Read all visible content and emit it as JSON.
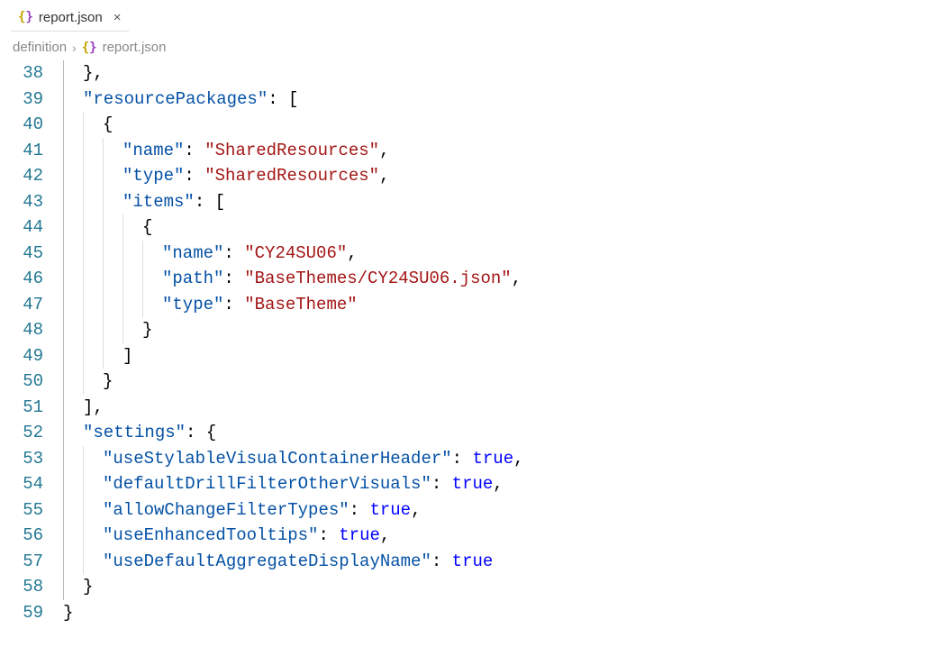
{
  "tab": {
    "filename": "report.json",
    "close": "×"
  },
  "breadcrumb": {
    "folder": "definition",
    "file": "report.json"
  },
  "lineStart": 38,
  "lines": [
    {
      "indent": 1,
      "tokens": [
        [
          "brace",
          "}"
        ],
        [
          "comma",
          ","
        ]
      ]
    },
    {
      "indent": 1,
      "tokens": [
        [
          "key",
          "\"resourcePackages\""
        ],
        [
          "colon",
          ":"
        ],
        [
          "sp",
          " "
        ],
        [
          "bracket",
          "["
        ]
      ]
    },
    {
      "indent": 2,
      "tokens": [
        [
          "brace",
          "{"
        ]
      ]
    },
    {
      "indent": 3,
      "tokens": [
        [
          "key",
          "\"name\""
        ],
        [
          "colon",
          ":"
        ],
        [
          "sp",
          " "
        ],
        [
          "string",
          "\"SharedResources\""
        ],
        [
          "comma",
          ","
        ]
      ]
    },
    {
      "indent": 3,
      "tokens": [
        [
          "key",
          "\"type\""
        ],
        [
          "colon",
          ":"
        ],
        [
          "sp",
          " "
        ],
        [
          "string",
          "\"SharedResources\""
        ],
        [
          "comma",
          ","
        ]
      ]
    },
    {
      "indent": 3,
      "tokens": [
        [
          "key",
          "\"items\""
        ],
        [
          "colon",
          ":"
        ],
        [
          "sp",
          " "
        ],
        [
          "bracket",
          "["
        ]
      ]
    },
    {
      "indent": 4,
      "tokens": [
        [
          "brace",
          "{"
        ]
      ]
    },
    {
      "indent": 5,
      "tokens": [
        [
          "key",
          "\"name\""
        ],
        [
          "colon",
          ":"
        ],
        [
          "sp",
          " "
        ],
        [
          "string",
          "\"CY24SU06\""
        ],
        [
          "comma",
          ","
        ]
      ]
    },
    {
      "indent": 5,
      "tokens": [
        [
          "key",
          "\"path\""
        ],
        [
          "colon",
          ":"
        ],
        [
          "sp",
          " "
        ],
        [
          "string",
          "\"BaseThemes/CY24SU06.json\""
        ],
        [
          "comma",
          ","
        ]
      ]
    },
    {
      "indent": 5,
      "tokens": [
        [
          "key",
          "\"type\""
        ],
        [
          "colon",
          ":"
        ],
        [
          "sp",
          " "
        ],
        [
          "string",
          "\"BaseTheme\""
        ]
      ]
    },
    {
      "indent": 4,
      "tokens": [
        [
          "brace",
          "}"
        ]
      ]
    },
    {
      "indent": 3,
      "tokens": [
        [
          "bracket",
          "]"
        ]
      ]
    },
    {
      "indent": 2,
      "tokens": [
        [
          "brace",
          "}"
        ]
      ]
    },
    {
      "indent": 1,
      "tokens": [
        [
          "bracket",
          "]"
        ],
        [
          "comma",
          ","
        ]
      ]
    },
    {
      "indent": 1,
      "tokens": [
        [
          "key",
          "\"settings\""
        ],
        [
          "colon",
          ":"
        ],
        [
          "sp",
          " "
        ],
        [
          "brace",
          "{"
        ]
      ]
    },
    {
      "indent": 2,
      "tokens": [
        [
          "key",
          "\"useStylableVisualContainerHeader\""
        ],
        [
          "colon",
          ":"
        ],
        [
          "sp",
          " "
        ],
        [
          "bool",
          "true"
        ],
        [
          "comma",
          ","
        ]
      ]
    },
    {
      "indent": 2,
      "tokens": [
        [
          "key",
          "\"defaultDrillFilterOtherVisuals\""
        ],
        [
          "colon",
          ":"
        ],
        [
          "sp",
          " "
        ],
        [
          "bool",
          "true"
        ],
        [
          "comma",
          ","
        ]
      ]
    },
    {
      "indent": 2,
      "tokens": [
        [
          "key",
          "\"allowChangeFilterTypes\""
        ],
        [
          "colon",
          ":"
        ],
        [
          "sp",
          " "
        ],
        [
          "bool",
          "true"
        ],
        [
          "comma",
          ","
        ]
      ]
    },
    {
      "indent": 2,
      "tokens": [
        [
          "key",
          "\"useEnhancedTooltips\""
        ],
        [
          "colon",
          ":"
        ],
        [
          "sp",
          " "
        ],
        [
          "bool",
          "true"
        ],
        [
          "comma",
          ","
        ]
      ]
    },
    {
      "indent": 2,
      "tokens": [
        [
          "key",
          "\"useDefaultAggregateDisplayName\""
        ],
        [
          "colon",
          ":"
        ],
        [
          "sp",
          " "
        ],
        [
          "bool",
          "true"
        ]
      ]
    },
    {
      "indent": 1,
      "tokens": [
        [
          "brace",
          "}"
        ]
      ]
    },
    {
      "indent": 0,
      "tokens": [
        [
          "brace",
          "}"
        ]
      ]
    }
  ]
}
